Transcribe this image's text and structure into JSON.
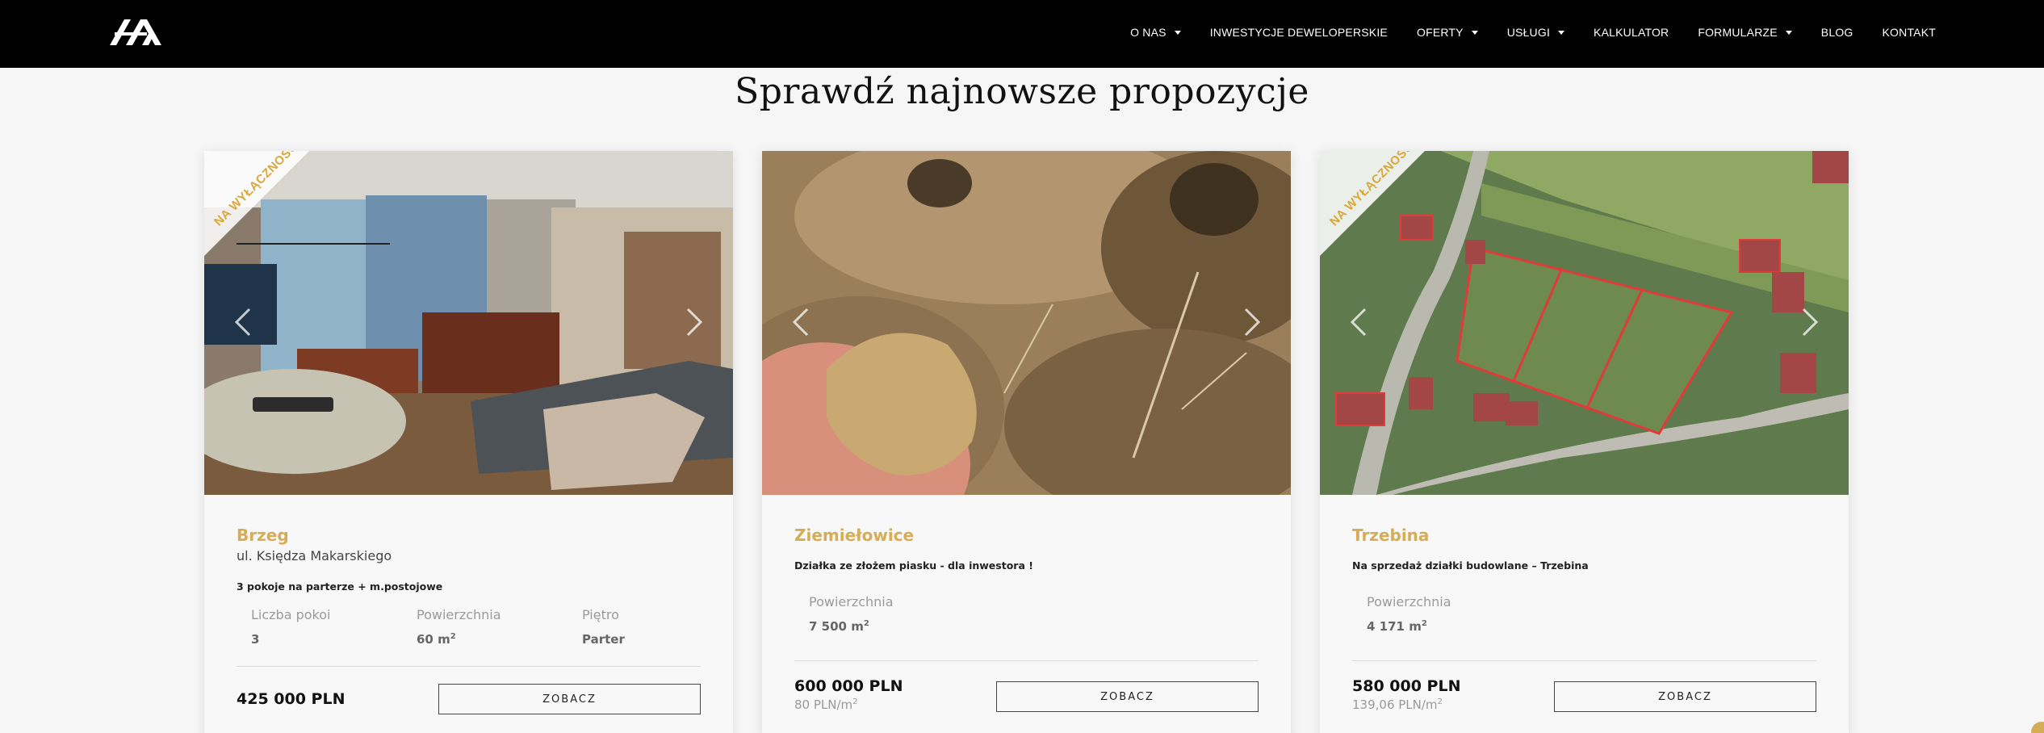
{
  "colors": {
    "accent": "#d6ad55",
    "header_bg": "#000000",
    "page_bg": "#f6f6f6"
  },
  "header": {
    "logo_icon": "house-logo-icon",
    "nav": [
      {
        "label": "O NAS",
        "dropdown": true
      },
      {
        "label": "INWESTYCJE DEWELOPERSKIE",
        "dropdown": false
      },
      {
        "label": "OFERTY",
        "dropdown": true
      },
      {
        "label": "USŁUGI",
        "dropdown": true
      },
      {
        "label": "KALKULATOR",
        "dropdown": false
      },
      {
        "label": "FORMULARZE",
        "dropdown": true
      },
      {
        "label": "BLOG",
        "dropdown": false
      },
      {
        "label": "KONTAKT",
        "dropdown": false
      }
    ]
  },
  "section": {
    "title": "Sprawdź najnowsze propozycje"
  },
  "cards": [
    {
      "ribbon": "NA WYŁĄCZNOŚĆ",
      "city": "Brzeg",
      "street": "ul. Księdza Makarskiego",
      "description": "3 pokoje na parterze + m.postojowe",
      "specs": [
        {
          "label": "Liczba pokoi",
          "value": "3"
        },
        {
          "label": "Powierzchnia",
          "value": "60 m",
          "unit_sup": "2"
        },
        {
          "label": "Piętro",
          "value": "Parter"
        }
      ],
      "price": "425 000 PLN",
      "button": "ZOBACZ"
    },
    {
      "city": "Ziemiełowice",
      "description": "Działka ze złożem piasku - dla inwestora !",
      "specs": [
        {
          "label": "Powierzchnia",
          "value": "7 500 m",
          "unit_sup": "2"
        }
      ],
      "price": "600 000 PLN",
      "price_per_m": "80 PLN/m",
      "price_per_m_sup": "2",
      "button": "ZOBACZ"
    },
    {
      "ribbon": "NA WYŁĄCZNOŚĆ",
      "city": "Trzebina",
      "description": "Na sprzedaż działki budowlane – Trzebina",
      "specs": [
        {
          "label": "Powierzchnia",
          "value": "4 171 m",
          "unit_sup": "2"
        }
      ],
      "price": "580 000 PLN",
      "price_per_m": "139,06 PLN/m",
      "price_per_m_sup": "2",
      "button": "ZOBACZ"
    }
  ]
}
